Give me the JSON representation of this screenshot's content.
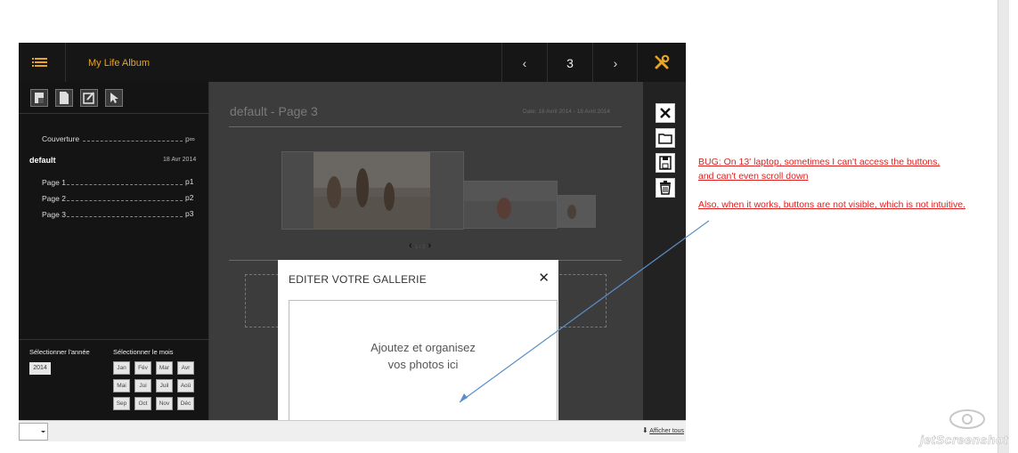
{
  "app": {
    "title": "My Life Album",
    "page_number": "3",
    "prev_symbol": "‹",
    "next_symbol": "›"
  },
  "sidebar": {
    "toc": [
      {
        "label": "Couverture",
        "page": "p∞"
      },
      {
        "label": "Page 1",
        "page": "p1"
      },
      {
        "label": "Page 2",
        "page": "p2"
      },
      {
        "label": "Page 3",
        "page": "p3"
      }
    ],
    "album_name": "default",
    "album_date": "18 Avr 2014",
    "year_label": "Sélectionner l'année",
    "month_label": "Sélectionner le mois",
    "year_value": "2014",
    "months": [
      "Jan",
      "Fév",
      "Mar",
      "Avr",
      "Mai",
      "Jui",
      "Juil",
      "Aoû",
      "Sep",
      "Oct",
      "Nov",
      "Déc"
    ]
  },
  "main": {
    "page_title": "default - Page 3",
    "page_date": "Date: 18 Avril 2014 - 18 Avril 2014",
    "gallery_counter": "1 / 3"
  },
  "modal": {
    "title": "EDITER VOTRE GALLERIE",
    "close_symbol": "✕",
    "drop_line1": "Ajoutez et organisez",
    "drop_line2": "vos photos ici"
  },
  "statusbar": {
    "link_label": "Afficher tous"
  },
  "annotation": {
    "line1": "BUG: On 13' laptop, sometimes I can't access the buttons,",
    "line2": "and can't even scroll down",
    "line3": "Also, when it works, buttons are not visible, which is not intuitive."
  },
  "watermark": "jetScreenshot",
  "colors": {
    "accent": "#e8a427",
    "annotation": "#dd2222",
    "arrow": "#5b8fc9",
    "app_bg": "#1a1a1a"
  },
  "icons": [
    "menu-icon",
    "chevron-left-icon",
    "chevron-right-icon",
    "tools-icon",
    "close-icon",
    "folder-icon",
    "save-icon",
    "trash-icon",
    "new-page-icon",
    "blank-page-icon",
    "edit-icon",
    "cursor-icon"
  ]
}
